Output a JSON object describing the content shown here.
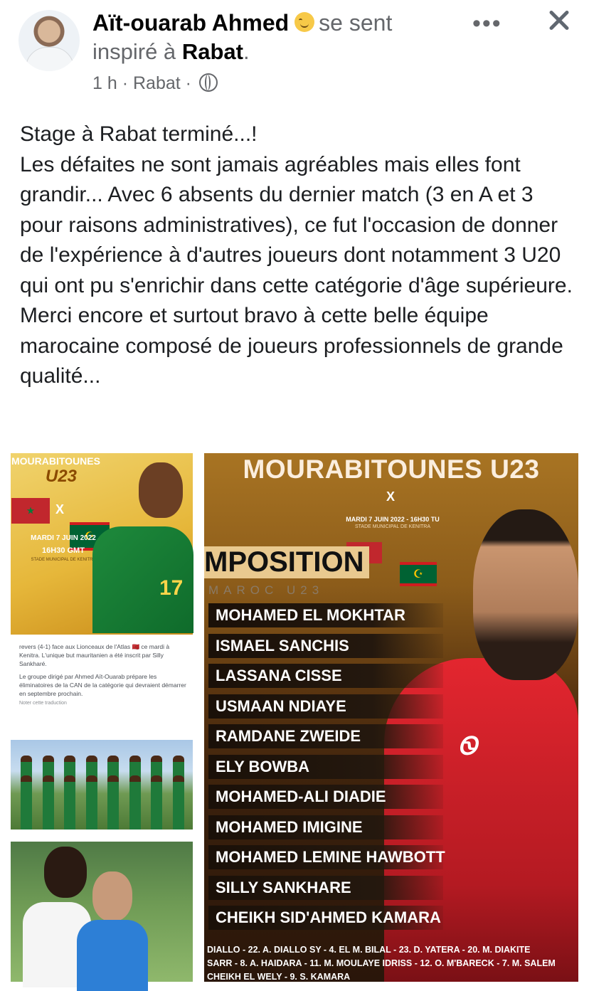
{
  "post": {
    "author": "Aït-ouarab Ahmed",
    "feeling": "se sent",
    "feeling_prefix": "inspiré à",
    "location": "Rabat",
    "time": "1 h",
    "place": "Rabat",
    "more_label": "•••",
    "paragraphs": [
      "Stage à Rabat terminé...!",
      "Les défaites ne sont jamais agréables mais elles font grandir... Avec 6 absents du dernier match (3 en A et 3 pour raisons administratives), ce fut l'occasion de donner de l'expérience à d'autres joueurs dont notamment 3 U20 qui ont pu s'enrichir dans cette catégorie d'âge supérieure. Merci encore et surtout bravo à cette belle équipe marocaine composé de joueurs professionnels de grande qualité..."
    ]
  },
  "left_poster": {
    "title": "MOURABITOUNES",
    "subtitle": "U23",
    "x": "X",
    "date": "MARDI 7 JUIN 2022",
    "time": "16H30 GMT",
    "stade": "STADE MUNICIPAL DE KENITRA",
    "jersey_number": "17"
  },
  "news": {
    "line1": "revers (4-1) face aux Lionceaux de l'Atlas 🇲🇦 ce mardi à Kenitra. L'unique but mauritanien a été inscrit par Silly Sankharé.",
    "line2": "Le groupe dirigé par Ahmed Aït-Ouarab prépare les éliminatoires de la CAN de la catégorie qui devraient démarrer en septembre prochain.",
    "translate": "Noter cette traduction"
  },
  "right_poster": {
    "title": "MOURABITOUNES U23",
    "x": "X",
    "date": "MARDI 7 JUIN 2022 - 16H30 TU",
    "stade": "STADE MUNICIPAL DE KENITRA",
    "composition": "MPOSITION",
    "opponent": "MAROC U23",
    "shirt_logo": "Ꮻ",
    "roster": [
      "MOHAMED EL MOKHTAR",
      "ISMAEL SANCHIS",
      "LASSANA CISSE",
      "USMAAN NDIAYE",
      "RAMDANE ZWEIDE",
      "ELY BOWBA",
      "MOHAMED-ALI DIADIE",
      "MOHAMED IMIGINE",
      "MOHAMED LEMINE HAWBOTT",
      "SILLY SANKHARE",
      "CHEIKH SID'AHMED KAMARA"
    ],
    "subs": [
      "DIALLO - 22. A. DIALLO SY - 4. EL M. BILAL - 23. D. YATERA - 20. M. DIAKITE",
      "SARR - 8. A. HAIDARA - 11. M. MOULAYE IDRISS - 12. O. M'BARECK - 7. M. SALEM",
      "CHEIKH EL WELY - 9. S. KAMARA"
    ]
  }
}
